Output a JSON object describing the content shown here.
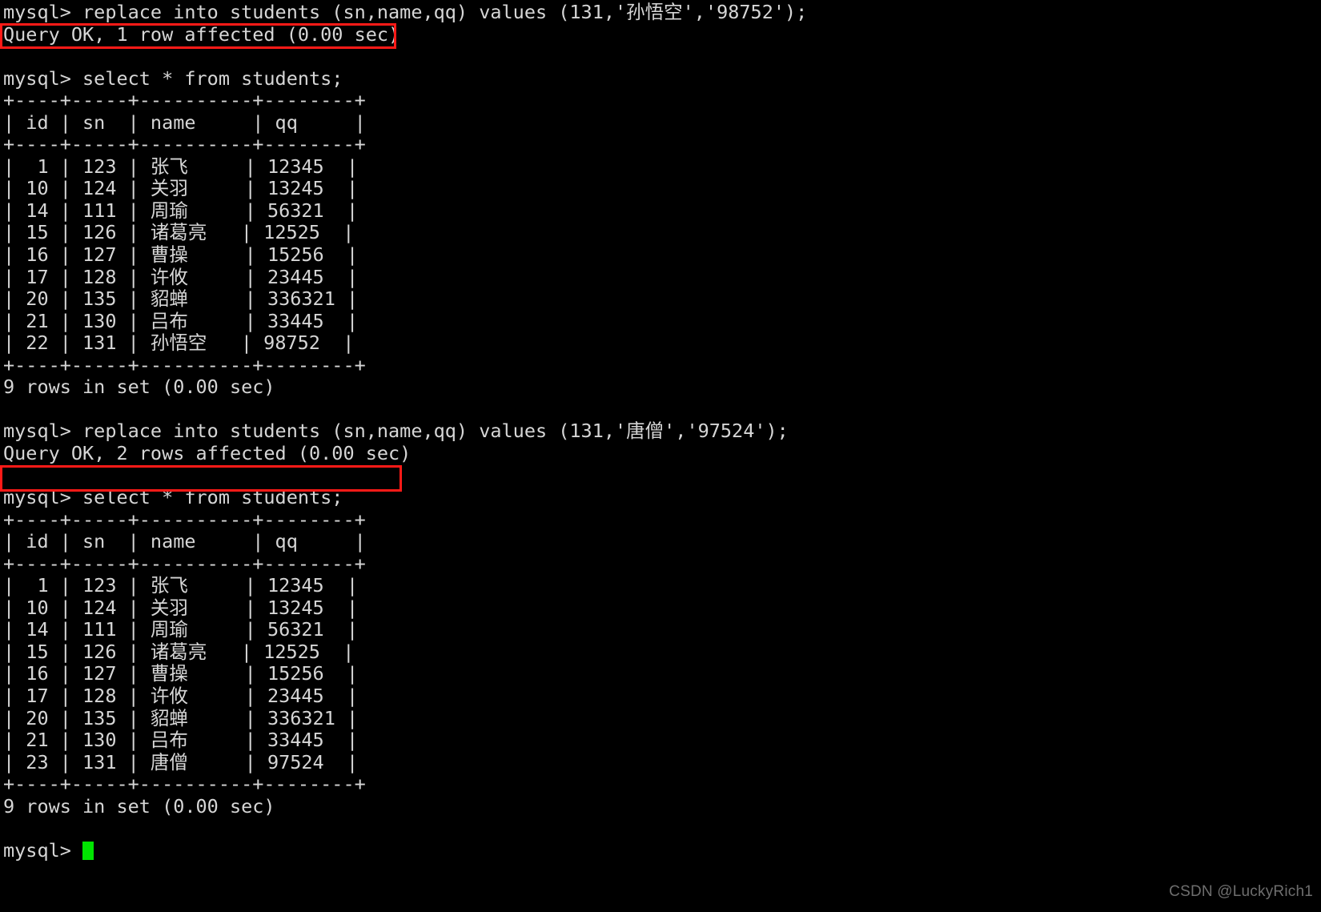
{
  "terminal": {
    "prompt": "mysql>",
    "background_color": "#000000",
    "text_color": "#d6d6d6",
    "highlight_color": "#ff1a17",
    "cursor_color": "#00e500",
    "lines": [
      "mysql> replace into students (sn,name,qq) values (131,'孙悟空','98752');",
      "Query OK, 1 row affected (0.00 sec)",
      "",
      "mysql> select * from students;",
      "+----+-----+----------+--------+",
      "| id | sn  | name     | qq     |",
      "+----+-----+----------+--------+",
      "|  1 | 123 | 张飞     | 12345  |",
      "| 10 | 124 | 关羽     | 13245  |",
      "| 14 | 111 | 周瑜     | 56321  |",
      "| 15 | 126 | 诸葛亮   | 12525  |",
      "| 16 | 127 | 曹操     | 15256  |",
      "| 17 | 128 | 许攸     | 23445  |",
      "| 20 | 135 | 貂蝉     | 336321 |",
      "| 21 | 130 | 吕布     | 33445  |",
      "| 22 | 131 | 孙悟空   | 98752  |",
      "+----+-----+----------+--------+",
      "9 rows in set (0.00 sec)",
      "",
      "mysql> replace into students (sn,name,qq) values (131,'唐僧','97524');",
      "Query OK, 2 rows affected (0.00 sec)",
      "",
      "mysql> select * from students;",
      "+----+-----+----------+--------+",
      "| id | sn  | name     | qq     |",
      "+----+-----+----------+--------+",
      "|  1 | 123 | 张飞     | 12345  |",
      "| 10 | 124 | 关羽     | 13245  |",
      "| 14 | 111 | 周瑜     | 56321  |",
      "| 15 | 126 | 诸葛亮   | 12525  |",
      "| 16 | 127 | 曹操     | 15256  |",
      "| 17 | 128 | 许攸     | 23445  |",
      "| 20 | 135 | 貂蝉     | 336321 |",
      "| 21 | 130 | 吕布     | 33445  |",
      "| 23 | 131 | 唐僧     | 97524  |",
      "+----+-----+----------+--------+",
      "9 rows in set (0.00 sec)",
      ""
    ],
    "final_prompt": "mysql> "
  },
  "queries": [
    {
      "command": "replace into students (sn,name,qq) values (131,'孙悟空','98752');",
      "result": "Query OK, 1 row affected (0.00 sec)",
      "highlighted": true
    },
    {
      "command": "select * from students;",
      "result": "9 rows in set (0.00 sec)",
      "highlighted": false
    },
    {
      "command": "replace into students (sn,name,qq) values (131,'唐僧','97524');",
      "result": "Query OK, 2 rows affected (0.00 sec)",
      "highlighted": true
    },
    {
      "command": "select * from students;",
      "result": "9 rows in set (0.00 sec)",
      "highlighted": false
    }
  ],
  "tables": [
    {
      "columns": [
        "id",
        "sn",
        "name",
        "qq"
      ],
      "rows": [
        [
          "1",
          "123",
          "张飞",
          "12345"
        ],
        [
          "10",
          "124",
          "关羽",
          "13245"
        ],
        [
          "14",
          "111",
          "周瑜",
          "56321"
        ],
        [
          "15",
          "126",
          "诸葛亮",
          "12525"
        ],
        [
          "16",
          "127",
          "曹操",
          "15256"
        ],
        [
          "17",
          "128",
          "许攸",
          "23445"
        ],
        [
          "20",
          "135",
          "貂蝉",
          "336321"
        ],
        [
          "21",
          "130",
          "吕布",
          "33445"
        ],
        [
          "22",
          "131",
          "孙悟空",
          "98752"
        ]
      ],
      "row_count_text": "9 rows in set (0.00 sec)"
    },
    {
      "columns": [
        "id",
        "sn",
        "name",
        "qq"
      ],
      "rows": [
        [
          "1",
          "123",
          "张飞",
          "12345"
        ],
        [
          "10",
          "124",
          "关羽",
          "13245"
        ],
        [
          "14",
          "111",
          "周瑜",
          "56321"
        ],
        [
          "15",
          "126",
          "诸葛亮",
          "12525"
        ],
        [
          "16",
          "127",
          "曹操",
          "15256"
        ],
        [
          "17",
          "128",
          "许攸",
          "23445"
        ],
        [
          "20",
          "135",
          "貂蝉",
          "336321"
        ],
        [
          "21",
          "130",
          "吕布",
          "33445"
        ],
        [
          "23",
          "131",
          "唐僧",
          "97524"
        ]
      ],
      "row_count_text": "9 rows in set (0.00 sec)"
    }
  ],
  "watermark": {
    "text": "CSDN @LuckyRich1"
  }
}
